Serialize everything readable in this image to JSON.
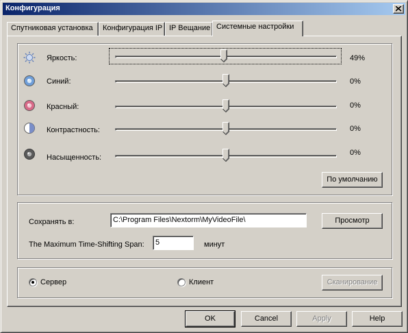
{
  "window": {
    "title": "Конфигурация"
  },
  "tabs": [
    {
      "label": "Спутниковая установка"
    },
    {
      "label": "Конфигурация IP"
    },
    {
      "label": "IP Вещание"
    },
    {
      "label": "Системные настройки"
    }
  ],
  "video": {
    "sliders": [
      {
        "label": "Яркость:",
        "value_text": "49%",
        "icon": "brightness-icon",
        "level": 0.49
      },
      {
        "label": "Синий:",
        "value_text": "0%",
        "icon": "blue-icon",
        "level": 0.5
      },
      {
        "label": "Красный:",
        "value_text": "0%",
        "icon": "red-icon",
        "level": 0.5
      },
      {
        "label": "Контрастность:",
        "value_text": "0%",
        "icon": "contrast-icon",
        "level": 0.5
      },
      {
        "label": "Насыщенность:",
        "value_text": "0%",
        "icon": "saturation-icon",
        "level": 0.5
      }
    ],
    "default_button": "По умолчанию"
  },
  "save": {
    "label": "Сохранять в:",
    "path": "C:\\Program Files\\Nextorm\\MyVideoFile\\",
    "browse_button": "Просмотр",
    "timeshift_label": "The Maximum Time-Shifting Span:",
    "timeshift_value": "5",
    "timeshift_unit": "минут"
  },
  "mode": {
    "server_label": "Сервер",
    "client_label": "Клиент",
    "selected": "server",
    "scan_button": "Сканирование"
  },
  "footer": {
    "ok": "OK",
    "cancel": "Cancel",
    "apply": "Apply",
    "help": "Help"
  },
  "colors": {
    "titlebar_start": "#0a246a",
    "titlebar_end": "#a6caf0",
    "face": "#d4d0c8"
  }
}
